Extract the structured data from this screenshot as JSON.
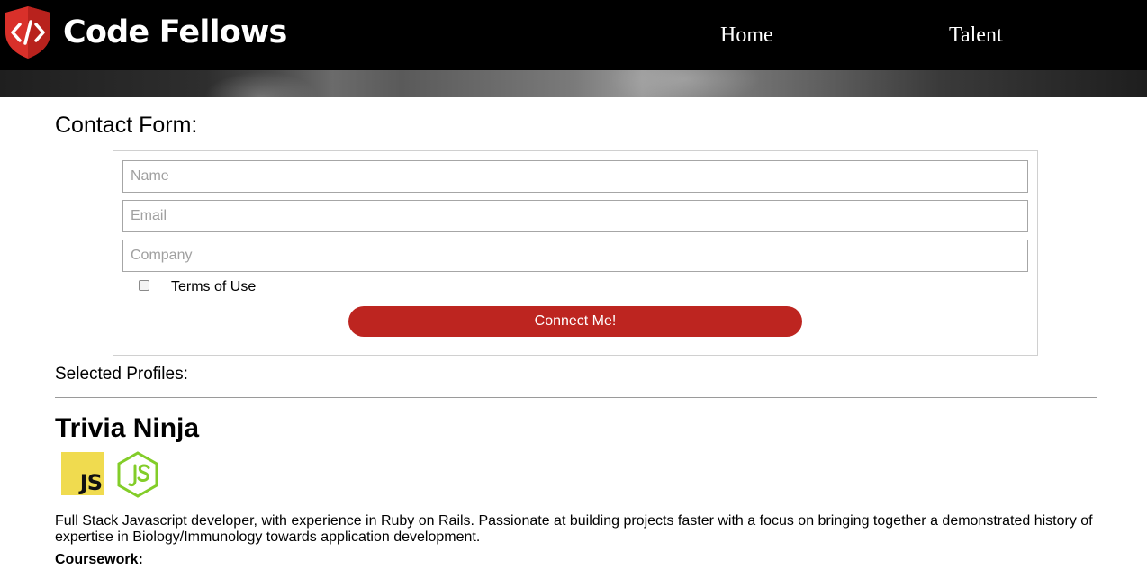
{
  "header": {
    "brand": "Code Fellows",
    "nav": {
      "home": "Home",
      "talent": "Talent"
    }
  },
  "contact_form": {
    "title": "Contact Form:",
    "name_placeholder": "Name",
    "email_placeholder": "Email",
    "company_placeholder": "Company",
    "terms_label": "Terms of Use",
    "terms_checked": false,
    "submit_label": "Connect Me!"
  },
  "profiles": {
    "heading": "Selected Profiles:",
    "items": [
      {
        "name": "Trivia Ninja",
        "skills": [
          "javascript-icon",
          "nodejs-icon"
        ],
        "js_badge_text": "JS",
        "bio": "Full Stack Javascript developer, with experience in Ruby on Rails. Passionate at building projects faster with a focus on bringing together a demonstrated history of expertise in Biology/Immunology towards application development.",
        "coursework_label": "Coursework:"
      }
    ]
  },
  "colors": {
    "header_bg": "#000000",
    "brand_red": "#bd2520",
    "logo_red": "#d9302a",
    "js_yellow": "#f0db4f",
    "node_green": "#83cd29"
  }
}
